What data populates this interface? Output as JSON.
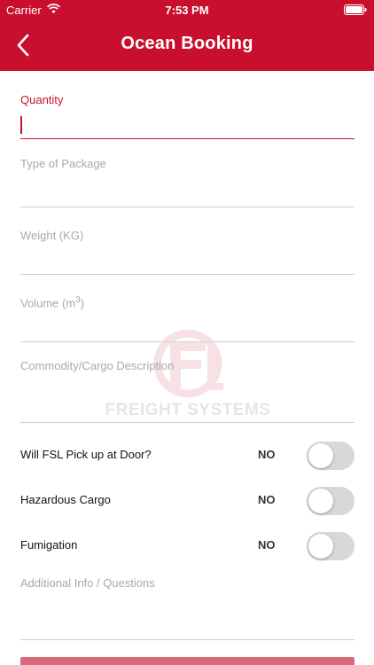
{
  "status": {
    "carrier": "Carrier",
    "time": "7:53 PM"
  },
  "header": {
    "title": "Ocean Booking"
  },
  "form": {
    "quantity_label": "Quantity",
    "package_label": "Type of Package",
    "weight_label": "Weight (KG)",
    "volume_label": "Volume (m",
    "volume_sup": "3",
    "volume_suffix": ")",
    "commodity_label": "Commodity/Cargo Description",
    "pickup_label": "Will FSL Pick up at Door?",
    "pickup_value": "NO",
    "hazardous_label": "Hazardous Cargo",
    "hazardous_value": "NO",
    "fumigation_label": "Fumigation",
    "fumigation_value": "NO",
    "additional_label": "Additional Info / Questions"
  },
  "watermark": {
    "text": "FREIGHT SYSTEMS",
    "monogram": "FSL"
  },
  "colors": {
    "accent": "#c8102e",
    "toggle_off": "#d8d8d8",
    "label": "#a9a9a9"
  },
  "icons": [
    "wifi-icon",
    "battery-icon",
    "back-chevron-icon"
  ]
}
